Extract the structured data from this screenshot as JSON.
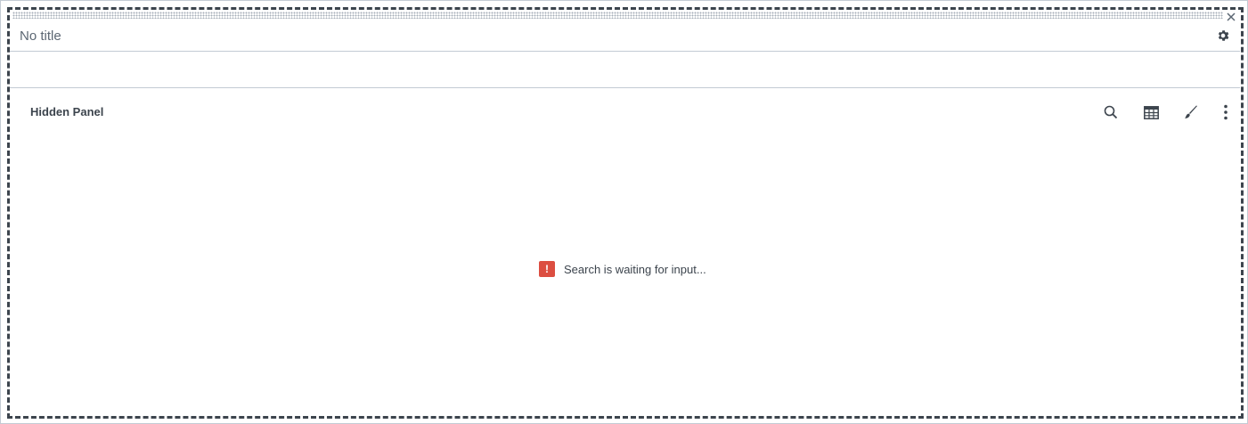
{
  "panel": {
    "title": "No title",
    "description": "",
    "visualization": {
      "title": "Hidden Panel",
      "status_icon_glyph": "!",
      "status_message": "Search is waiting for input...",
      "tools": [
        {
          "icon": "search-icon"
        },
        {
          "icon": "table-icon"
        },
        {
          "icon": "brush-icon"
        },
        {
          "icon": "more-vertical-icon"
        }
      ]
    }
  },
  "colors": {
    "error": "#dc4e41",
    "text": "#3c444d",
    "muted": "#5c6773",
    "border": "#c3cbd4"
  }
}
